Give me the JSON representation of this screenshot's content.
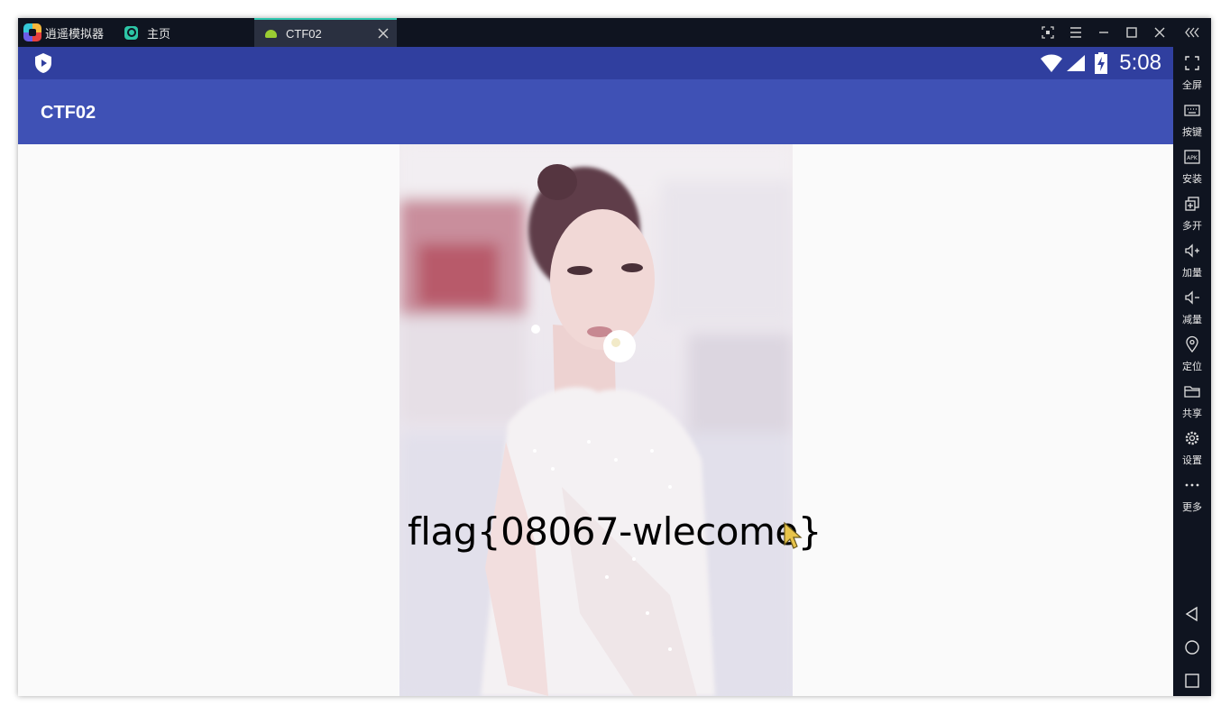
{
  "titlebar": {
    "app_name": "逍遥模拟器",
    "tabs": [
      {
        "label": "主页",
        "icon": "home-icon"
      },
      {
        "label": "CTF02",
        "icon": "android-icon",
        "active": true
      }
    ]
  },
  "statusbar": {
    "time": "5:08",
    "icons": [
      "shield-app-icon",
      "wifi-icon",
      "signal-icon",
      "battery-charging-icon"
    ]
  },
  "appbar": {
    "title": "CTF02"
  },
  "content": {
    "flag_text": "flag{08067-wlecome}"
  },
  "sidebar": {
    "tools": [
      {
        "label": "全屏",
        "icon": "fullscreen-icon"
      },
      {
        "label": "按键",
        "icon": "keyboard-icon"
      },
      {
        "label": "安装",
        "icon": "apk-icon"
      },
      {
        "label": "多开",
        "icon": "multi-instance-icon"
      },
      {
        "label": "加量",
        "icon": "volume-up-icon"
      },
      {
        "label": "减量",
        "icon": "volume-down-icon"
      },
      {
        "label": "定位",
        "icon": "location-icon"
      },
      {
        "label": "共享",
        "icon": "folder-icon"
      },
      {
        "label": "设置",
        "icon": "gear-icon"
      },
      {
        "label": "更多",
        "icon": "more-icon"
      }
    ],
    "nav": [
      "back-icon",
      "home-circle-icon",
      "recents-icon"
    ]
  },
  "colors": {
    "statusbar": "#303f9f",
    "appbar": "#3f51b5",
    "chrome": "#0f1420",
    "active_tab_accent": "#31c7b0"
  }
}
